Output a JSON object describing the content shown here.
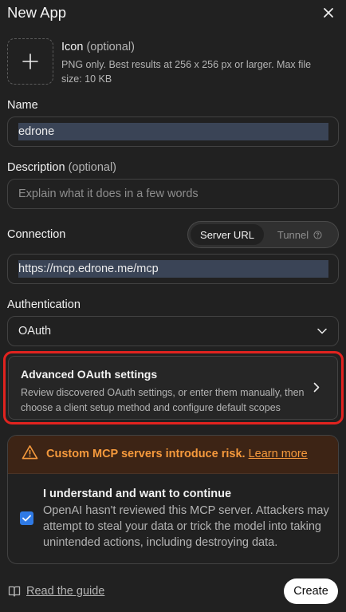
{
  "dialog": {
    "title": "New App"
  },
  "icon": {
    "label": "Icon",
    "optional": "(optional)",
    "help": "PNG only. Best results at 256 x 256 px or larger. Max file size: 10 KB"
  },
  "name": {
    "label": "Name",
    "value": "edrone"
  },
  "description": {
    "label": "Description",
    "optional": "(optional)",
    "placeholder": "Explain what it does in a few words"
  },
  "connection": {
    "label": "Connection",
    "options": [
      "Server URL",
      "Tunnel"
    ],
    "selected": "Server URL",
    "url": "https://mcp.edrone.me/mcp"
  },
  "authentication": {
    "label": "Authentication",
    "value": "OAuth"
  },
  "advanced": {
    "title": "Advanced OAuth settings",
    "description": "Review discovered OAuth settings, or enter them manually, then choose a client setup method and configure default scopes"
  },
  "risk": {
    "warning": "Custom MCP servers introduce risk.",
    "link": "Learn more",
    "ack_title": "I understand and want to continue",
    "ack_desc": "OpenAI hasn't reviewed this MCP server. Attackers may attempt to steal your data or trick the model into taking unintended actions, including destroying data.",
    "checked": true
  },
  "footer": {
    "guide": "Read the guide",
    "create": "Create"
  },
  "colors": {
    "background": "#212121",
    "warning": "#f5993c",
    "checkbox": "#2f7ae5",
    "highlight": "#e1231f"
  }
}
